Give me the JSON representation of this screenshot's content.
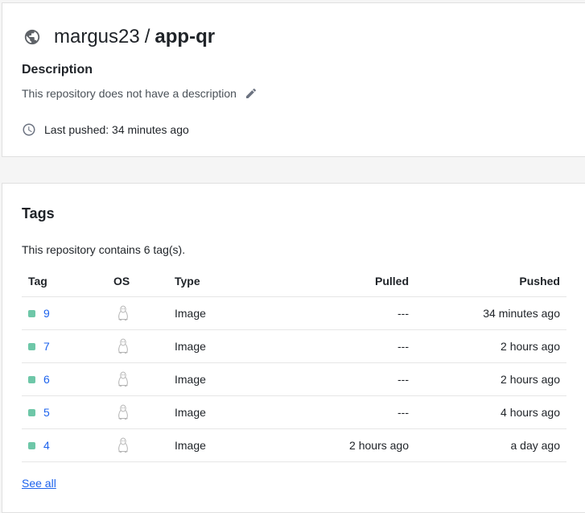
{
  "repo": {
    "owner": "margus23",
    "separator": "/",
    "name": "app-qr",
    "visibility_icon": "globe-icon"
  },
  "description": {
    "heading": "Description",
    "text": "This repository does not have a description",
    "edit_icon": "pencil-icon"
  },
  "last_pushed": {
    "icon": "clock-icon",
    "text": "Last pushed: 34 minutes ago"
  },
  "tags": {
    "heading": "Tags",
    "count_text": "This repository contains 6 tag(s).",
    "columns": [
      "Tag",
      "OS",
      "Type",
      "Pulled",
      "Pushed"
    ],
    "rows": [
      {
        "tag": "9",
        "os": "linux-icon",
        "type": "Image",
        "pulled": "---",
        "pushed": "34 minutes ago"
      },
      {
        "tag": "7",
        "os": "linux-icon",
        "type": "Image",
        "pulled": "---",
        "pushed": "2 hours ago"
      },
      {
        "tag": "6",
        "os": "linux-icon",
        "type": "Image",
        "pulled": "---",
        "pushed": "2 hours ago"
      },
      {
        "tag": "5",
        "os": "linux-icon",
        "type": "Image",
        "pulled": "---",
        "pushed": "4 hours ago"
      },
      {
        "tag": "4",
        "os": "linux-icon",
        "type": "Image",
        "pulled": "2 hours ago",
        "pushed": "a day ago"
      }
    ],
    "see_all_label": "See all"
  },
  "colors": {
    "link": "#1d63ed",
    "tag_dot": "#6ec7a8",
    "background": "#f5f5f5"
  }
}
